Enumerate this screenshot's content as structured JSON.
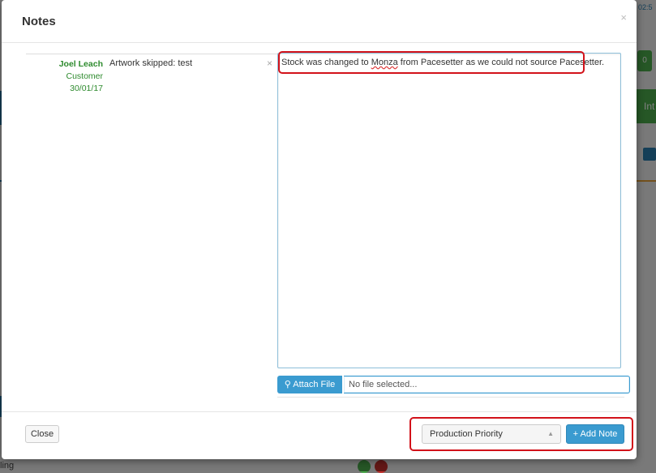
{
  "modal": {
    "title": "Notes",
    "close_x": "×"
  },
  "notes": [
    {
      "author": "Joel Leach",
      "role": "Customer",
      "date": "30/01/17",
      "text": "Artwork skipped: test",
      "delete_icon": "×"
    }
  ],
  "editor": {
    "text_before": "Stock was changed to ",
    "misspelled_word": "Monza",
    "text_after": " from Pacesetter as we could not source Pacesetter."
  },
  "attach": {
    "button_label": "Attach File",
    "file_status": "No file selected..."
  },
  "footer": {
    "close_label": "Close",
    "priority_value": "Production Priority",
    "add_note_label": "Add Note"
  },
  "background": {
    "time": "02:5",
    "badge": "0",
    "right_label": "Int",
    "bottom_text": "ling"
  },
  "colors": {
    "accent_blue": "#3a9bd0",
    "author_green": "#2e8b2e",
    "annotation_red": "#d2121a"
  }
}
